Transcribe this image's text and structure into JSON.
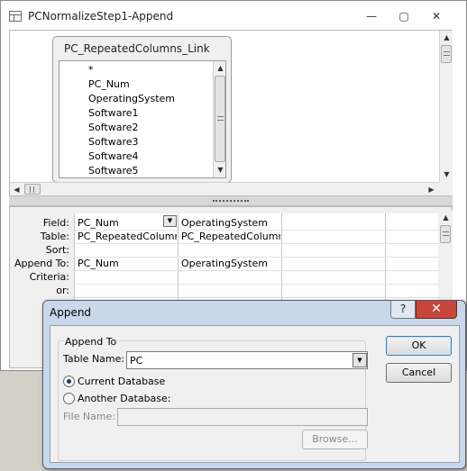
{
  "window": {
    "title": "PCNormalizeStep1-Append",
    "minimize_glyph": "—",
    "maximize_glyph": "▢",
    "close_glyph": "✕"
  },
  "table_box": {
    "title": "PC_RepeatedColumns_Link",
    "fields": [
      "*",
      "PC_Num",
      "OperatingSystem",
      "Software1",
      "Software2",
      "Software3",
      "Software4",
      "Software5"
    ]
  },
  "grid": {
    "row_labels": [
      "Field:",
      "Table:",
      "Sort:",
      "Append To:",
      "Criteria:",
      "or:"
    ],
    "columns": [
      {
        "field": "PC_Num",
        "table": "PC_RepeatedColumns",
        "sort": "",
        "append_to": "PC_Num",
        "criteria": "",
        "or": ""
      },
      {
        "field": "OperatingSystem",
        "table": "PC_RepeatedColumns",
        "sort": "",
        "append_to": "OperatingSystem",
        "criteria": "",
        "or": ""
      },
      {
        "field": "",
        "table": "",
        "sort": "",
        "append_to": "",
        "criteria": "",
        "or": ""
      },
      {
        "field": "",
        "table": "",
        "sort": "",
        "append_to": "",
        "criteria": "",
        "or": ""
      }
    ]
  },
  "dialog": {
    "title": "Append",
    "help_glyph": "?",
    "close_glyph": "✕",
    "group_label": "Append To",
    "table_name_label": "Table Name:",
    "table_name_value": "PC",
    "current_database_label": "Current Database",
    "another_database_label": "Another Database:",
    "file_name_label": "File Name:",
    "file_name_value": "",
    "browse_label": "Browse...",
    "ok_label": "OK",
    "cancel_label": "Cancel",
    "selected_option": "Current Database"
  },
  "icons": {
    "scroll_up": "▲",
    "scroll_down": "▼",
    "scroll_left": "◀",
    "scroll_right": "▶",
    "dropdown": "▼"
  },
  "colors": {
    "dialog_frame": "#c9d7e8",
    "close_button": "#c8453a",
    "ok_border": "#3c7fb1"
  }
}
